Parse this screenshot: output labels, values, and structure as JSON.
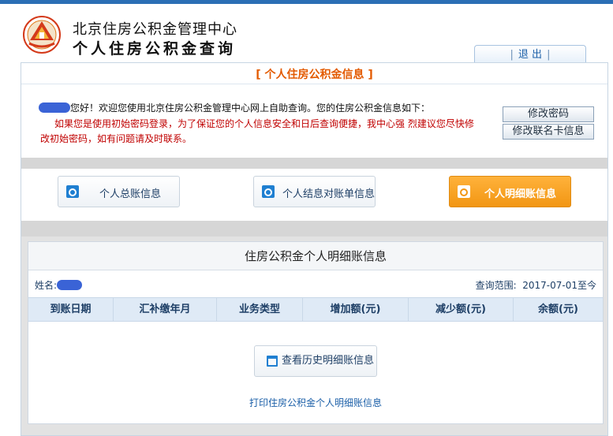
{
  "header": {
    "org_name": "北京住房公积金管理中心",
    "system_name": "个人住房公积金查询",
    "logout_label": "退 出",
    "logout_sep": "|"
  },
  "info": {
    "title": "[ 个人住房公积金信息 ]",
    "greeting": "您好！欢迎您使用北京住房公积金管理中心网上自助查询。您的住房公积金信息如下：",
    "warning": "如果您是使用初始密码登录，为了保证您的个人信息安全和日后查询便捷，我中心强 烈建议您尽快修改初始密码，如有问题请及时联系。",
    "change_password": "修改密码",
    "change_card": "修改联名卡信息"
  },
  "nav": {
    "items": [
      {
        "label": "个人总账信息",
        "active": false
      },
      {
        "label": "个人结息对账单信息",
        "active": false
      },
      {
        "label": "个人明细账信息",
        "active": true
      }
    ]
  },
  "detail": {
    "title": "住房公积金个人明细账信息",
    "name_label": "姓名:",
    "range_label": "查询范围:",
    "range_value": "2017-07-01至今",
    "columns": [
      "到账日期",
      "汇补缴年月",
      "业务类型",
      "增加额(元)",
      "减少额(元)",
      "余额(元)"
    ],
    "history_button": "查看历史明细账信息",
    "print_link": "打印住房公积金个人明细账信息"
  },
  "colors": {
    "accent_orange": "#f29613",
    "brand_blue": "#2b6fb5",
    "warning_red": "#c00000",
    "title_orange": "#e35a00"
  }
}
